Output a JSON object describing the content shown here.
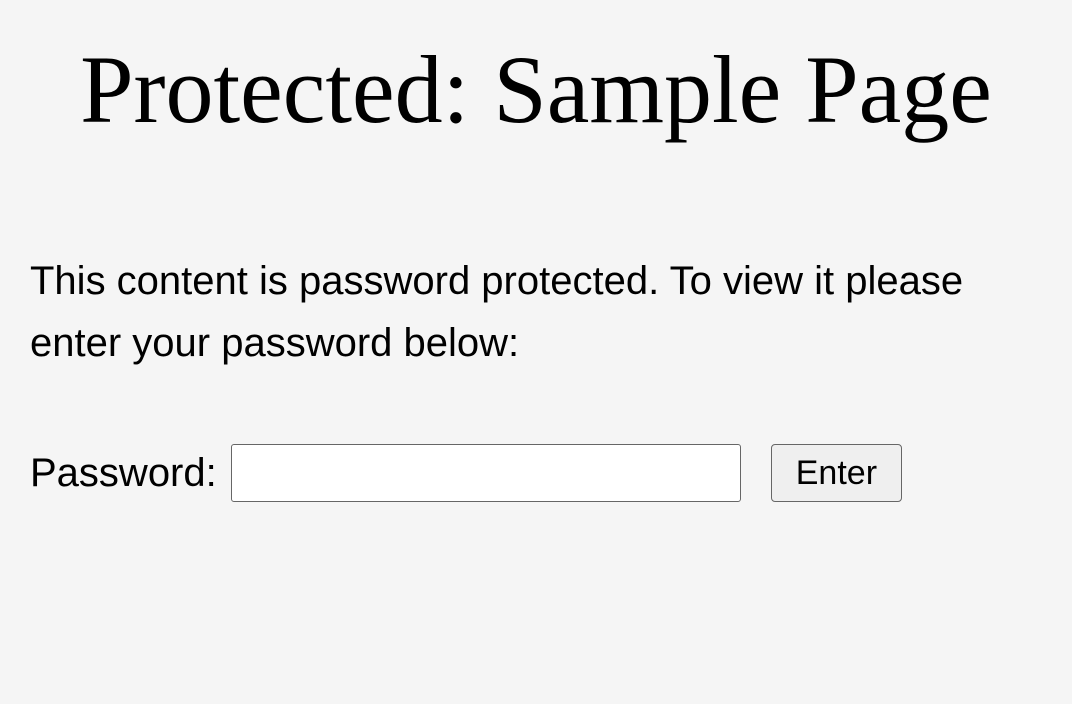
{
  "header": {
    "title": "Protected: Sample Page"
  },
  "content": {
    "description": "This content is password protected. To view it please enter your password below:"
  },
  "form": {
    "password_label": "Password:",
    "password_value": "",
    "submit_label": "Enter"
  }
}
